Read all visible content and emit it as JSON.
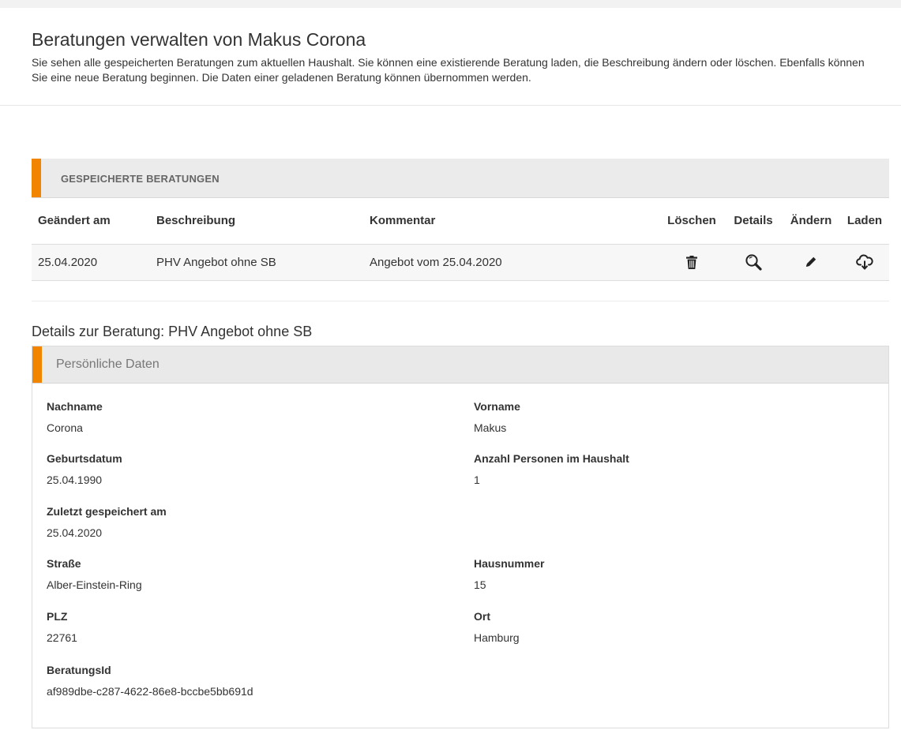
{
  "colors": {
    "accent": "#f28500",
    "text": "#333333",
    "header_bg": "#ebebeb"
  },
  "header": {
    "title": "Beratungen verwalten von Makus Corona",
    "intro": "Sie sehen alle gespeicherten Beratungen zum aktuellen Haushalt. Sie können eine existierende Beratung laden, die Beschreibung ändern oder löschen. Ebenfalls können Sie eine neue Beratung beginnen. Die Daten einer geladenen Beratung können übernommen werden."
  },
  "saved": {
    "title": "GESPEICHERTE BERATUNGEN",
    "columns": {
      "changed": "Geändert am",
      "description": "Beschreibung",
      "comment": "Kommentar",
      "delete": "Löschen",
      "details": "Details",
      "edit": "Ändern",
      "load": "Laden"
    },
    "rows": [
      {
        "changed": "25.04.2020",
        "description": "PHV Angebot ohne SB",
        "comment": "Angebot vom 25.04.2020",
        "icons": {
          "delete": "trash-icon",
          "details": "magnifier-icon",
          "edit": "pencil-icon",
          "load": "cloud-download-icon"
        }
      }
    ]
  },
  "details": {
    "heading": "Details zur Beratung: PHV Angebot ohne SB",
    "panel_title": "Persönliche Daten",
    "fields": {
      "nachname": {
        "label": "Nachname",
        "value": "Corona"
      },
      "vorname": {
        "label": "Vorname",
        "value": "Makus"
      },
      "geburtsdatum": {
        "label": "Geburtsdatum",
        "value": "25.04.1990"
      },
      "personen": {
        "label": "Anzahl Personen im Haushalt",
        "value": "1"
      },
      "gespeichert": {
        "label": "Zuletzt gespeichert am",
        "value": "25.04.2020"
      },
      "strasse": {
        "label": "Straße",
        "value": "Alber-Einstein-Ring"
      },
      "hausnummer": {
        "label": "Hausnummer",
        "value": "15"
      },
      "plz": {
        "label": "PLZ",
        "value": "22761"
      },
      "ort": {
        "label": "Ort",
        "value": "Hamburg"
      },
      "beratungsid": {
        "label": "BeratungsId",
        "value": "af989dbe-c287-4622-86e8-bccbe5bb691d"
      }
    }
  }
}
